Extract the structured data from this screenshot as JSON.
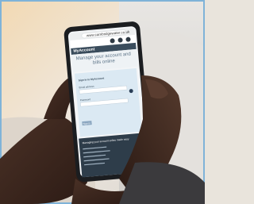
{
  "phone_screen": {
    "address_bar": {
      "url": "www.cambridgewater.co.uk"
    },
    "header": {
      "brand": "MyAccount"
    },
    "page_title": "Manage your account and bills online",
    "sign_in": {
      "heading": "Sign in to MyAccount",
      "email_label": "Email address",
      "password_label": "Password",
      "button_label": "Sign in"
    },
    "info_panel": {
      "heading": "Managing your account online made easy"
    }
  }
}
